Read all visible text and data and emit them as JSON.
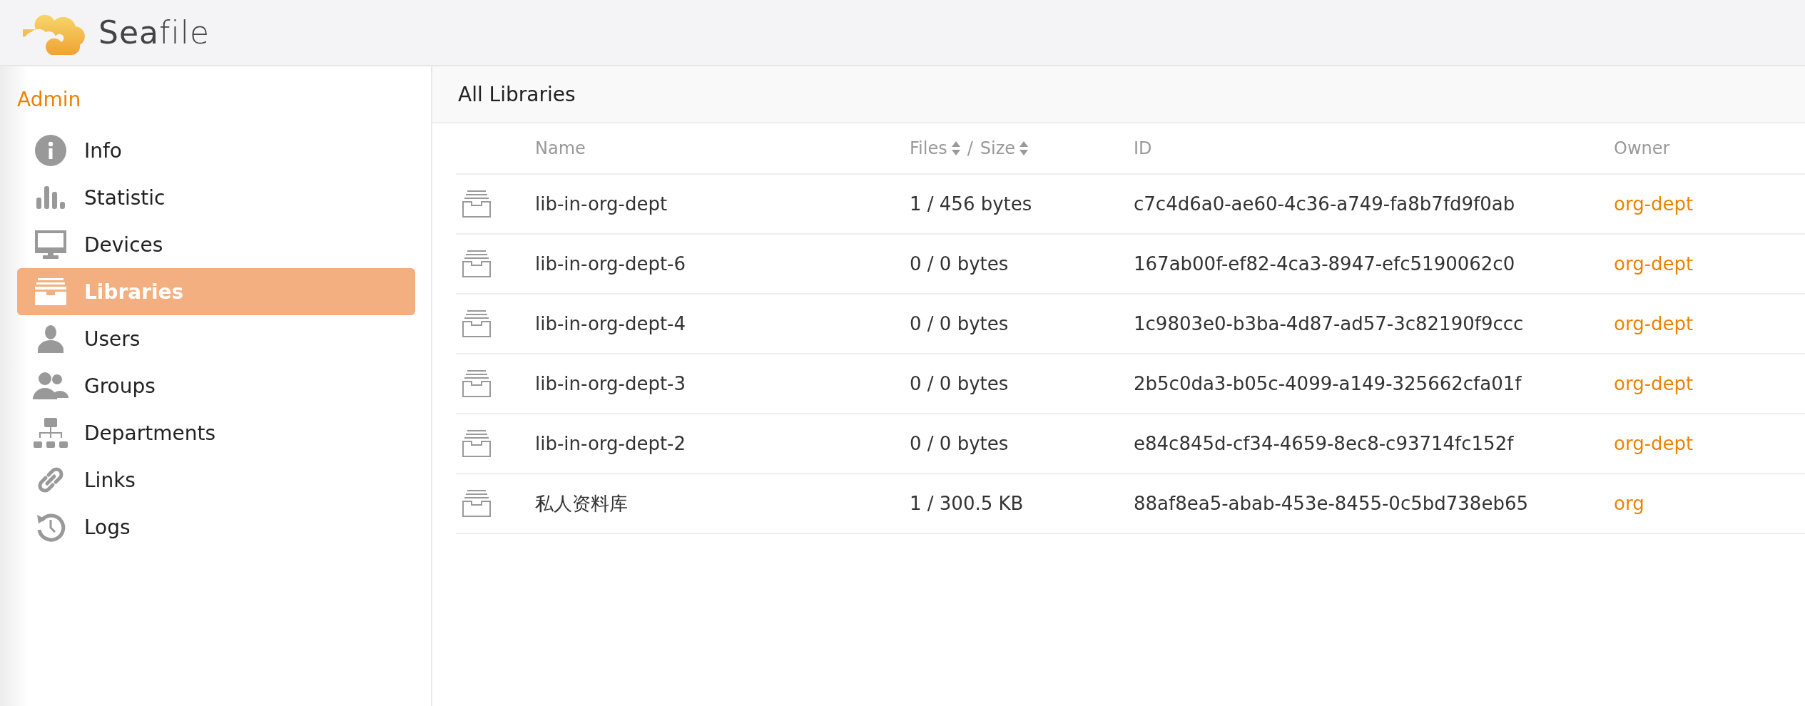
{
  "header": {
    "logo_text": "**Sea**file"
  },
  "sidebar": {
    "title": "Admin",
    "items": [
      {
        "label": "Info",
        "kind": "info",
        "selected": false
      },
      {
        "label": "Statistic",
        "kind": "chart",
        "selected": false
      },
      {
        "label": "Devices",
        "kind": "monitor",
        "selected": false
      },
      {
        "label": "Libraries",
        "kind": "archive",
        "selected": true
      },
      {
        "label": "Users",
        "kind": "user",
        "selected": false
      },
      {
        "label": "Groups",
        "kind": "users",
        "selected": false
      },
      {
        "label": "Departments",
        "kind": "sitemap",
        "selected": false
      },
      {
        "label": "Links",
        "kind": "link",
        "selected": false
      },
      {
        "label": "Logs",
        "kind": "history",
        "selected": false
      }
    ]
  },
  "main": {
    "title": "All Libraries",
    "table": {
      "columns": [
        {
          "label": "Name",
          "sortable": false
        },
        {
          "label": "Files",
          "sortable": true
        },
        {
          "label": "Size",
          "sortable": true
        },
        {
          "label": "ID",
          "sortable": false
        },
        {
          "label": "Owner",
          "sortable": false
        }
      ],
      "separator": "/",
      "rows": [
        {
          "name": "lib-in-org-dept",
          "files_size": "1 / 456 bytes",
          "id": "c7c4d6a0-ae60-4c36-a749-fa8b7fd9f0ab",
          "owner": "org-dept"
        },
        {
          "name": "lib-in-org-dept-6",
          "files_size": "0 / 0 bytes",
          "id": "167ab00f-ef82-4ca3-8947-efc5190062c0",
          "owner": "org-dept"
        },
        {
          "name": "lib-in-org-dept-4",
          "files_size": "0 / 0 bytes",
          "id": "1c9803e0-b3ba-4d87-ad57-3c82190f9ccc",
          "owner": "org-dept"
        },
        {
          "name": "lib-in-org-dept-3",
          "files_size": "0 / 0 bytes",
          "id": "2b5c0da3-b05c-4099-a149-325662cfa01f",
          "owner": "org-dept"
        },
        {
          "name": "lib-in-org-dept-2",
          "files_size": "0 / 0 bytes",
          "id": "e84c845d-cf34-4659-8ec8-c93714fc152f",
          "owner": "org-dept"
        },
        {
          "name": "私人资料库",
          "files_size": "1 / 300.5 KB",
          "id": "88af8ea5-abab-453e-8455-0c5bd738eb65",
          "owner": "org"
        }
      ]
    }
  }
}
